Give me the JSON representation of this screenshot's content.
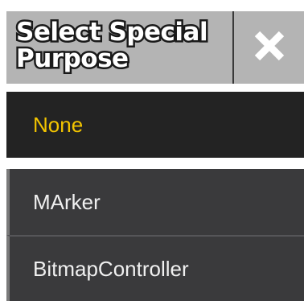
{
  "dialog": {
    "title": "Select Special Purpose",
    "close_icon": "close-x-icon"
  },
  "options": [
    {
      "label": "None",
      "selected": true
    },
    {
      "label": "MArker",
      "selected": false
    },
    {
      "label": "BitmapController",
      "selected": false
    }
  ],
  "colors": {
    "header_bg": "#b4b4b4",
    "selected_bg": "#232323",
    "selected_text": "#f2c400",
    "item_bg": "#3a3a3c",
    "item_text": "#f0f0f0"
  }
}
